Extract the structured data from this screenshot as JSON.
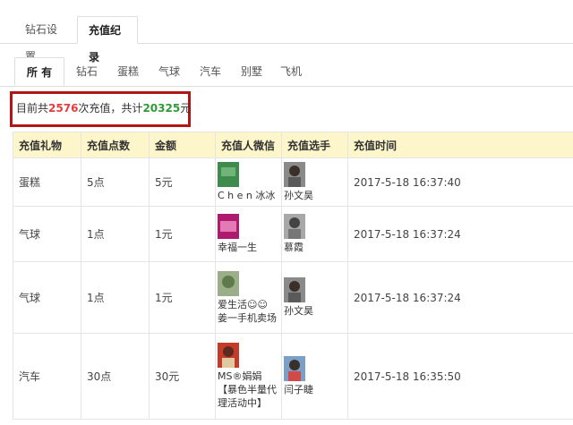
{
  "top_tabs": [
    "钻石设置",
    "充值纪录"
  ],
  "sub_tabs": [
    "所 有",
    "钻石",
    "蛋糕",
    "气球",
    "汽车",
    "别墅",
    "飞机"
  ],
  "summary": {
    "prefix": "目前共",
    "count": "2576",
    "middle": "次充值，共计",
    "total": "20325",
    "suffix": "元"
  },
  "table": {
    "headers": [
      "充值礼物",
      "充值点数",
      "金额",
      "充值人微信",
      "充值选手",
      "充值时间"
    ],
    "rows": [
      {
        "gift": "蛋糕",
        "points": "5点",
        "amount": "5元",
        "payer": "C h e n  冰冰",
        "player": "孙文昊",
        "time": "2017-5-18 16:37:40"
      },
      {
        "gift": "气球",
        "points": "1点",
        "amount": "1元",
        "payer": "幸福一生",
        "player": "慕霞",
        "time": "2017-5-18 16:37:24"
      },
      {
        "gift": "气球",
        "points": "1点",
        "amount": "1元",
        "payer": "爱生活☺☺ 姜一手机卖场",
        "player": "孙文昊",
        "time": "2017-5-18 16:37:24"
      },
      {
        "gift": "汽车",
        "points": "30点",
        "amount": "30元",
        "payer": "MS®娟娟【暴色半量代理活动中】",
        "player": "闫子睫",
        "time": "2017-5-18 16:35:50"
      }
    ]
  },
  "colors": {
    "highlight_border": "#b31515",
    "count_color": "#e43c3c",
    "total_color": "#2e9b37",
    "header_bg": "#fdf6ca"
  }
}
